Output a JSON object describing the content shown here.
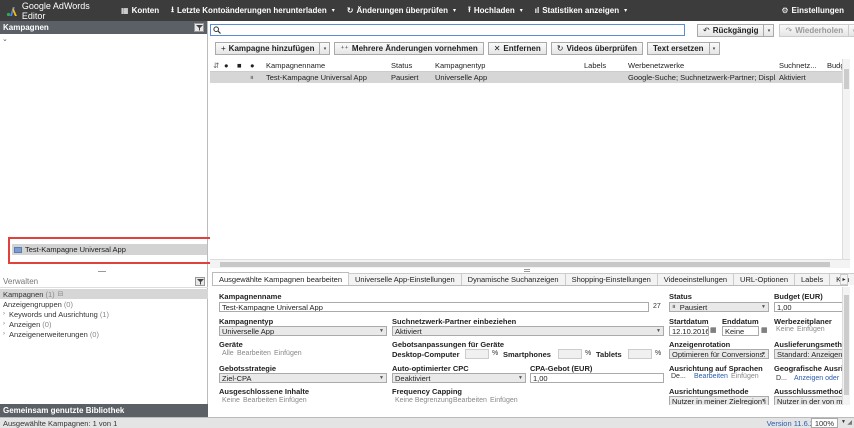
{
  "app": {
    "title": "Google AdWords Editor",
    "brand_color": "#3c3c3c"
  },
  "menu": {
    "accounts": "Konten",
    "download": "Letzte Kontoänderungen herunterladen",
    "review": "Änderungen überprüfen",
    "upload": "Hochladen",
    "stats": "Statistiken anzeigen",
    "settings": "Einstellungen"
  },
  "campaigns_pane": {
    "header": "Kampagnen",
    "selected_item": "Test-Kampagne Universal App"
  },
  "manage": {
    "header": "Verwalten",
    "items": [
      {
        "label": "Kampagnen",
        "count": "(1)"
      },
      {
        "label": "Anzeigengruppen",
        "count": "(0)"
      },
      {
        "label": "Keywords und Ausrichtung",
        "count": "(1)"
      },
      {
        "label": "Anzeigen",
        "count": "(0)"
      },
      {
        "label": "Anzeigenerweiterungen",
        "count": "(0)"
      }
    ],
    "shared_library": "Gemeinsam genutzte Bibliothek"
  },
  "search": {
    "value": ""
  },
  "undo": {
    "undo_label": "Rückgängig",
    "redo_label": "Wiederholen"
  },
  "toolbar": {
    "add_campaign": "Kampagne hinzufügen",
    "multi_change": "Mehrere Änderungen vornehmen",
    "remove": "Entfernen",
    "check_videos": "Videos überprüfen",
    "replace_text": "Text ersetzen"
  },
  "grid": {
    "columns": [
      "Kampagnenname",
      "Status",
      "Kampagnentyp",
      "Labels",
      "Werbenetzwerke",
      "Suchnetz...",
      "Budg"
    ],
    "rows": [
      {
        "name": "Test-Kampagne Universal App",
        "status": "Pausiert",
        "type": "Universelle App",
        "labels": "",
        "networks": "Google-Suche; Suchnetzwerk-Partner; Displ...",
        "search_partners": "Aktiviert",
        "budget": ""
      }
    ]
  },
  "tabs": [
    "Ausgewählte Kampagnen bearbeiten",
    "Universelle App-Einstellungen",
    "Dynamische Suchanzeigen",
    "Shopping-Einstellungen",
    "Videoeinstellungen",
    "URL-Optionen",
    "Labels",
    "Kon"
  ],
  "edit": {
    "campaign_name_label": "Kampagnenname",
    "campaign_name_value": "Test-Kampagne Universal App",
    "char_count": "27",
    "status_label": "Status",
    "status_value": "Pausiert",
    "budget_label": "Budget (EUR)",
    "budget_value": "1,00",
    "campaign_type_label": "Kampagnentyp",
    "campaign_type_value": "Universelle App",
    "search_partners_label": "Suchnetzwerk-Partner einbeziehen",
    "search_partners_value": "Aktiviert",
    "start_date_label": "Startdatum",
    "start_date_value": "12.10.2016",
    "end_date_label": "Enddatum",
    "end_date_value": "Keine",
    "scheduler_label": "Werbezeitplaner",
    "scheduler_none": "Keine",
    "scheduler_add": "Einfügen",
    "devices_label": "Geräte",
    "devices_all": "Alle",
    "devices_edit": "Bearbeiten",
    "devices_add": "Einfügen",
    "bid_adjust_label": "Gebotsanpassungen für Geräte",
    "desktop_label": "Desktop-Computer",
    "smartphones_label": "Smartphones",
    "tablets_label": "Tablets",
    "percent": "%",
    "ad_rotation_label": "Anzeigenrotation",
    "ad_rotation_value": "Optimieren für Conversions:",
    "delivery_label": "Auslieferungsmeth",
    "delivery_value": "Standard: Anzeigen a",
    "bid_strategy_label": "Gebotsstrategie",
    "bid_strategy_value": "Ziel-CPA",
    "auto_cpc_label": "Auto-optimierter CPC",
    "auto_cpc_value": "Deaktiviert",
    "cpa_bid_label": "CPA-Gebot (EUR)",
    "cpa_bid_value": "1,00",
    "language_label": "Ausrichtung auf Sprachen",
    "language_value": "De...",
    "language_edit": "Bearbeiten",
    "language_add": "Einfügen",
    "geo_label": "Geografische Ausri",
    "geo_value": "D...",
    "geo_link": "Anzeigen oder",
    "excluded_label": "Ausgeschlossene Inhalte",
    "excluded_none": "Keine",
    "excluded_edit": "Bearbeiten",
    "excluded_add": "Einfügen",
    "freq_label": "Frequency Capping",
    "freq_none": "Keine Begrenzung",
    "freq_edit": "Bearbeiten",
    "freq_add": "Einfügen",
    "targeting_method_label": "Ausrichtungsmethode",
    "targeting_method_value": "Nutzer in meiner Zielregion i",
    "exclusion_method_label": "Ausschlussmethode",
    "exclusion_method_value": "Nutzer in der von mi"
  },
  "status": {
    "selection": "Ausgewählte Kampagnen: 1 von 1",
    "version": "Version 11.6.2",
    "zoom": "100%"
  }
}
